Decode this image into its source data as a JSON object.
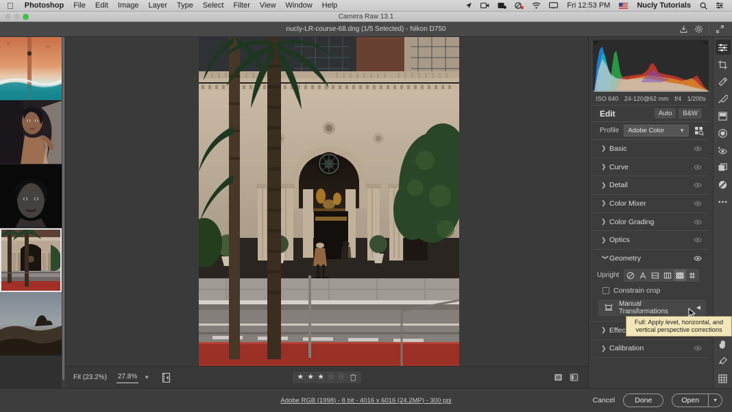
{
  "menubar": {
    "apple": "apple-logo",
    "items": [
      {
        "label": "Photoshop",
        "bold": true
      },
      {
        "label": "File",
        "bold": false
      },
      {
        "label": "Edit",
        "bold": false
      },
      {
        "label": "Image",
        "bold": false
      },
      {
        "label": "Layer",
        "bold": false
      },
      {
        "label": "Type",
        "bold": false
      },
      {
        "label": "Select",
        "bold": false
      },
      {
        "label": "Filter",
        "bold": false
      },
      {
        "label": "View",
        "bold": false
      },
      {
        "label": "Window",
        "bold": false
      },
      {
        "label": "Help",
        "bold": false
      }
    ],
    "status_icons": [
      "location-arrow-icon",
      "screen-record-icon",
      "screen-capture-icon",
      "do-not-disturb-icon",
      "wifi-icon",
      "airplay-icon"
    ],
    "clock": "Fri 12:53 PM",
    "flag": "us-flag-icon",
    "user": "Nucly Tutorials",
    "right_icons": [
      "search-icon",
      "control-center-icon"
    ]
  },
  "window": {
    "title": "Camera Raw 13.1"
  },
  "camera_raw_topbar": {
    "filename": "nucly-LR-course-68.dng (1/5 Selected)  -  Nikon D750",
    "icons": [
      "save-image-icon",
      "preferences-gear-icon",
      "fullscreen-icon"
    ]
  },
  "filmstrip": {
    "thumbnails": [
      {
        "name": "thumb-aerial-beach",
        "selected": false
      },
      {
        "name": "thumb-portrait-veil",
        "selected": false
      },
      {
        "name": "thumb-bw-portrait",
        "selected": false
      },
      {
        "name": "thumb-building-palms",
        "selected": true
      },
      {
        "name": "thumb-landscape-dusk",
        "selected": false
      }
    ]
  },
  "canvas_toolbar": {
    "fit_label": "Fit (23.2%)",
    "zoom_value": "27.8%",
    "zoom_caret": "chevron-down-icon",
    "filmstrip_toggle": "filmstrip-toggle-icon",
    "rating": {
      "value": 3,
      "max": 5,
      "trash": "trash-icon"
    },
    "view_modes": [
      "single-view-icon",
      "before-after-view-icon"
    ]
  },
  "edit_panel": {
    "histogram": {
      "name": "histogram",
      "clip_left": "shadow-clipping-icon",
      "clip_right": "highlight-clipping-icon"
    },
    "exif": [
      "ISO 640",
      "24-120@62 mm",
      "f/4",
      "1/200s"
    ],
    "header": {
      "title": "Edit",
      "auto": "Auto",
      "bw": "B&W"
    },
    "profile": {
      "label": "Profile",
      "value": "Adobe Color",
      "browser_icon": "profile-browser-icon"
    },
    "sections": [
      {
        "name": "Basic",
        "open": false
      },
      {
        "name": "Curve",
        "open": false
      },
      {
        "name": "Detail",
        "open": false
      },
      {
        "name": "Color Mixer",
        "open": false
      },
      {
        "name": "Color Grading",
        "open": false
      },
      {
        "name": "Optics",
        "open": false
      },
      {
        "name": "Geometry",
        "open": true
      }
    ],
    "geometry": {
      "upright_label": "Upright",
      "upright_buttons": [
        {
          "name": "upright-off-icon",
          "active": false
        },
        {
          "name": "upright-auto-icon",
          "active": false
        },
        {
          "name": "upright-level-icon",
          "active": false
        },
        {
          "name": "upright-vertical-icon",
          "active": false
        },
        {
          "name": "upright-full-icon",
          "active": true
        },
        {
          "name": "upright-guided-icon",
          "active": false
        }
      ],
      "constrain_label": "Constrain crop",
      "constrain_checked": false,
      "manual_label": "Manual Transformations",
      "manual_icon": "manual-transform-icon"
    },
    "sections_after": [
      {
        "name": "Effects",
        "open": false
      },
      {
        "name": "Calibration",
        "open": false
      }
    ],
    "tooltip": "Full: Apply level, horizontal, and vertical perspective corrections"
  },
  "tool_rail": {
    "top_tools": [
      {
        "name": "edit-sliders-icon",
        "active": true
      },
      {
        "name": "crop-icon",
        "active": false
      },
      {
        "name": "spot-removal-icon",
        "active": false
      },
      {
        "name": "adjustment-brush-icon",
        "active": false
      },
      {
        "name": "graduated-filter-icon",
        "active": false
      },
      {
        "name": "radial-filter-icon",
        "active": false
      },
      {
        "name": "red-eye-icon",
        "active": false
      },
      {
        "name": "snapshots-icon",
        "active": false
      },
      {
        "name": "presets-icon",
        "active": false
      },
      {
        "name": "more-options-icon",
        "active": false
      }
    ],
    "bottom_tools": [
      {
        "name": "zoom-tool-icon",
        "active": true
      },
      {
        "name": "hand-tool-icon",
        "active": false
      },
      {
        "name": "white-balance-eyedropper-icon",
        "active": false
      },
      {
        "name": "grid-overlay-icon",
        "active": false
      }
    ]
  },
  "statusbar": {
    "image_info": "Adobe RGB (1998) - 8 bit - 4016 x 6016 (24.2MP) - 300 ppi",
    "cancel": "Cancel",
    "done": "Done",
    "open": "Open",
    "open_caret": "chevron-down-icon"
  },
  "colors": {
    "panel_bg": "#3c3c3c",
    "stage_bg": "#3a3a3a",
    "accent_tooltip": "#f2e6b8",
    "selected_outline": "#e8e8e8"
  }
}
